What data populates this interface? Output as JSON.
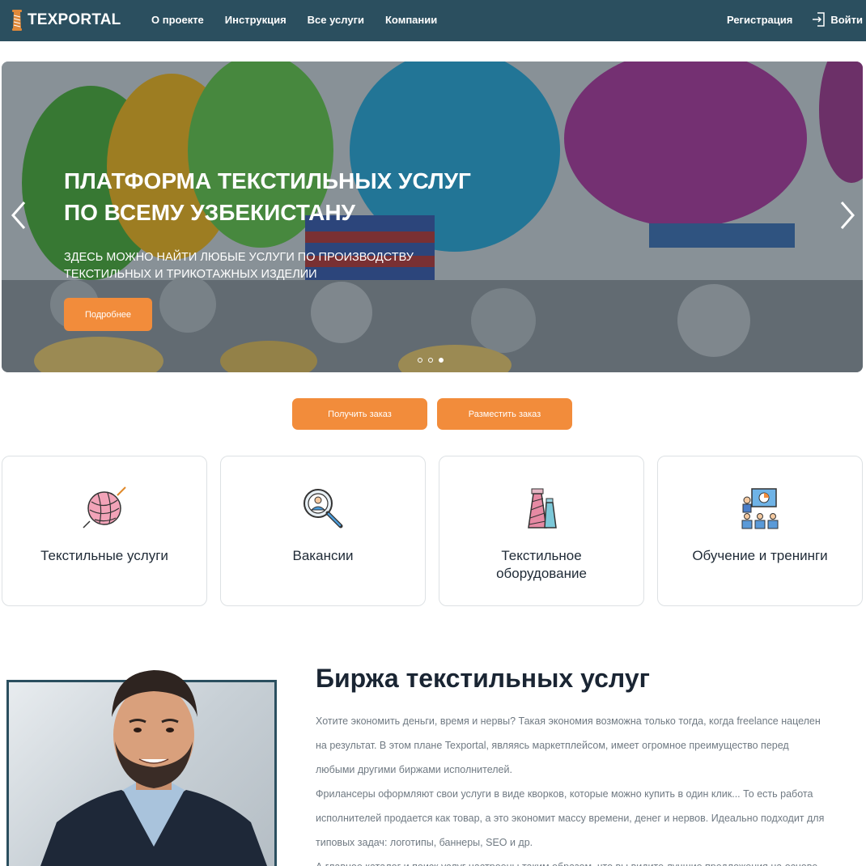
{
  "nav": {
    "logo_text": "TEXPORTAL",
    "links": [
      "О проекте",
      "Инструкция",
      "Все услуги",
      "Компании"
    ],
    "register": "Регистрация",
    "login": "Войти"
  },
  "hero": {
    "title_line1": "ПЛАТФОРМА ТЕКСТИЛЬНЫХ УСЛУГ",
    "title_line2": "ПО ВСЕМУ УЗБЕКИСТАНУ",
    "subtitle_line1": "ЗДЕСЬ МОЖНО НАЙТИ ЛЮБЫЕ УСЛУГИ ПО ПРОИЗВОДСТВУ",
    "subtitle_line2": "ТЕКСТИЛЬНЫХ И ТРИКОТАЖНЫХ ИЗДЕЛИИ",
    "button": "Подробнее",
    "slides_count": 3,
    "active_slide": 3
  },
  "actions": {
    "get_order": "Получить заказ",
    "place_order": "Разместить заказ"
  },
  "categories": [
    {
      "label": "Текстильные услуги",
      "icon": "yarn-ball-icon"
    },
    {
      "label": "Вакансии",
      "icon": "search-person-icon"
    },
    {
      "label": "Текстильное оборудование",
      "icon": "thread-spools-icon"
    },
    {
      "label": "Обучение и тренинги",
      "icon": "training-presentation-icon"
    }
  ],
  "about": {
    "title": "Биржа текстильных услуг",
    "lines": [
      "Хотите экономить деньги, время и нервы? Такая экономия возможна только тогда, когда freelance нацелен",
      "на результат. В этом плане Texportal, являясь маркетплейсом, имеет огромное преимущество перед",
      "любыми другими биржами исполнителей.",
      "Фрилансеры оформляют свои услуги в виде кворков, которые можно купить в один клик... То есть работа",
      "исполнителей продается как товар, а это экономит массу времени, денег и нервов. Идеально подходит для",
      "типовых задач: логотипы, баннеры, SEO и др.",
      "А главное каталог и поиск услуг настроены таким образом, что вы видите лучшие предложения на основе"
    ]
  },
  "colors": {
    "nav_bg": "#2b4f5f",
    "accent": "#f28c3b"
  }
}
